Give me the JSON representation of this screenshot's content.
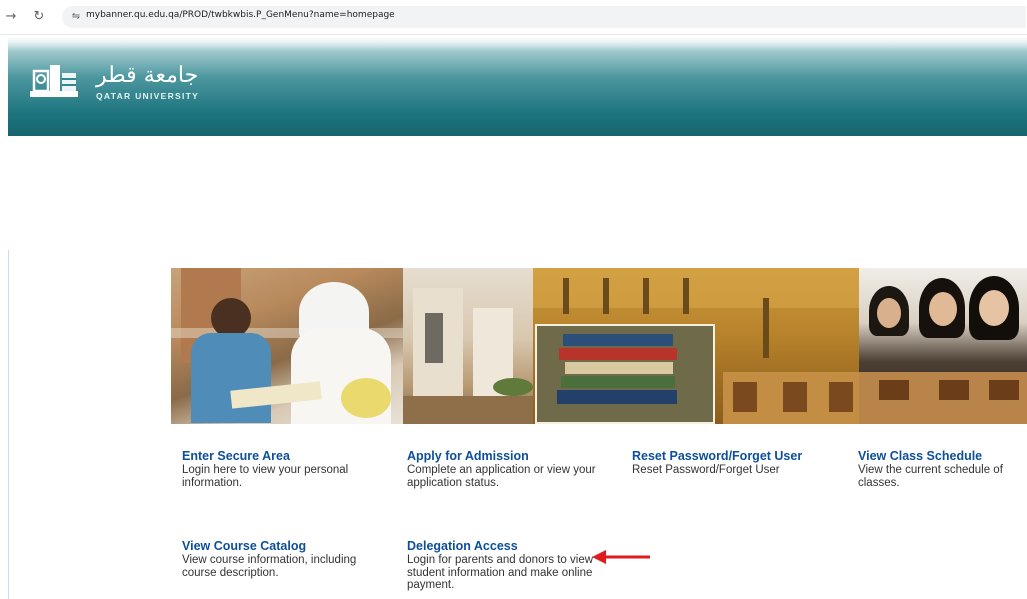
{
  "browser": {
    "url": "mybanner.qu.edu.qa/PROD/twbkwbis.P_GenMenu?name=homepage",
    "back_icon": "arrow-right-icon",
    "reload_icon": "reload-icon"
  },
  "header": {
    "logo_arabic": "جامعة قطر",
    "logo_english": "QATAR UNIVERSITY"
  },
  "menu": {
    "items": [
      {
        "title": "Enter Secure Area",
        "description": "Login here to view your personal information."
      },
      {
        "title": "Apply for Admission",
        "description": "Complete an application or view your application status."
      },
      {
        "title": "Reset Password/Forget User",
        "description": "Reset Password/Forget User"
      },
      {
        "title": "View Class Schedule",
        "description": "View the current schedule of classes."
      },
      {
        "title": "View Course Catalog",
        "description": "View course information, including course description."
      },
      {
        "title": "Delegation Access",
        "description": "Login for parents and donors to view student information and make online payment."
      }
    ]
  },
  "colors": {
    "link": "#0d4f9c",
    "header_teal": "#1f7680",
    "annotation_arrow": "#e01b1b"
  }
}
